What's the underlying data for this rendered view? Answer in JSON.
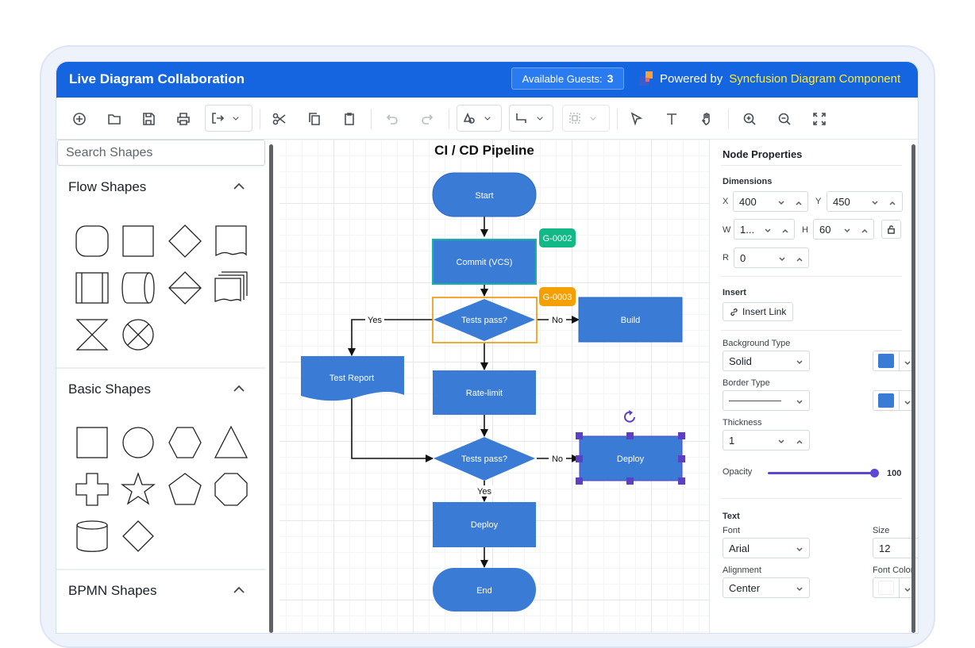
{
  "header": {
    "title": "Live Diagram Collaboration",
    "guests_label": "Available Guests:",
    "guests_count": "3",
    "powered_prefix": "Powered by",
    "powered_brand": "Syncfusion Diagram Component"
  },
  "toolbar": {
    "items": [
      "new-icon",
      "open-icon",
      "save-icon",
      "print-icon",
      "export-icon",
      "cut-icon",
      "copy-icon",
      "paste-icon",
      "undo-icon",
      "redo-icon",
      "draw-shape-icon",
      "connector-icon",
      "align-icon",
      "select-icon",
      "text-icon",
      "pan-icon",
      "zoom-in-icon",
      "zoom-out-icon",
      "fit-icon"
    ]
  },
  "palette": {
    "search_placeholder": "Search Shapes",
    "groups": [
      {
        "title": "Flow Shapes"
      },
      {
        "title": "Basic Shapes"
      },
      {
        "title": "BPMN Shapes"
      }
    ]
  },
  "diagram": {
    "title": "CI / CD Pipeline",
    "nodes": {
      "start": "Start",
      "commit": "Commit (VCS)",
      "tests1": "Tests pass?",
      "build": "Build",
      "report": "Test Report",
      "ratelimit": "Rate-limit",
      "tests2": "Tests pass?",
      "deploy_side": "Deploy",
      "deploy": "Deploy",
      "end": "End"
    },
    "badges": {
      "commit": "G-0002",
      "tests1": "G-0003"
    },
    "edge_labels": {
      "yes1": "Yes",
      "no1": "No",
      "no2": "No",
      "yes2": "Yes"
    },
    "colors": {
      "node_fill": "#3a7bd5",
      "badge_green": "#12b886",
      "badge_orange": "#f59f00",
      "selection": "#5b3fc4"
    }
  },
  "properties": {
    "title": "Node Properties",
    "dimensions_label": "Dimensions",
    "x_label": "X",
    "x_value": "400",
    "y_label": "Y",
    "y_value": "450",
    "w_label": "W",
    "w_value": "1...",
    "h_label": "H",
    "h_value": "60",
    "r_label": "R",
    "r_value": "0",
    "insert_label": "Insert",
    "insert_link": "Insert Link",
    "bg_type_label": "Background Type",
    "bg_type_value": "Solid",
    "border_type_label": "Border Type",
    "thickness_label": "Thickness",
    "thickness_value": "1",
    "opacity_label": "Opacity",
    "opacity_value": "100",
    "text_label": "Text",
    "font_label": "Font",
    "font_value": "Arial",
    "size_label": "Size",
    "size_value": "12",
    "alignment_label": "Alignment",
    "alignment_value": "Center",
    "font_color_label": "Font Color",
    "bg_color": "#3a7bd5",
    "border_color": "#3a7bd5",
    "font_color": "#ffffff"
  }
}
